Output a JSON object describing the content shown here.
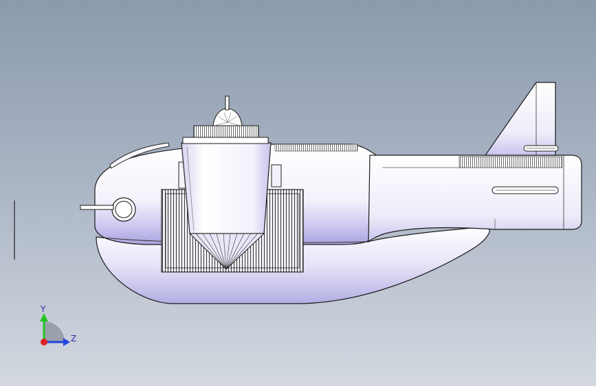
{
  "viewport": {
    "background_top": "#8c9aae",
    "background_bottom": "#d3d8e0"
  },
  "model": {
    "body_fill": "#ffffff",
    "body_shade": "#b9b4e6",
    "edge_color": "#1a1a1a"
  },
  "triad": {
    "y_label": "Y",
    "z_label": "Z",
    "y_color": "#22c422",
    "z_color": "#2244dd",
    "x_color": "#dd2222"
  },
  "icons": [
    "coordinate-triad-icon"
  ]
}
